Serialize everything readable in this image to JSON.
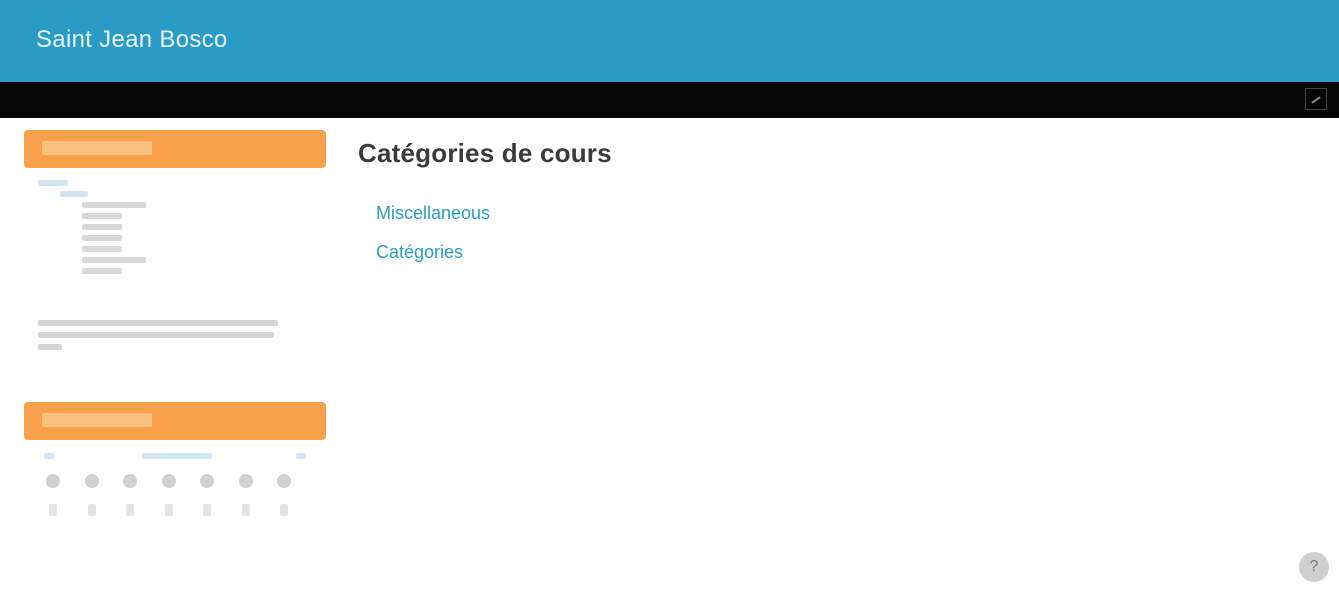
{
  "header": {
    "site_title": "Saint Jean Bosco"
  },
  "sidebar": {
    "navigation_block": {},
    "calendar_block": {
      "weekdays": [
        "",
        "",
        "",
        "",
        "",
        "",
        ""
      ],
      "day_numbers": [
        "",
        "",
        "",
        "",
        "",
        "",
        ""
      ]
    },
    "colors": {
      "block_header": "#f9a04b",
      "link": "#2a9bc7"
    }
  },
  "main": {
    "page_title": "Catégories de cours",
    "search_link": "",
    "categories": [
      {
        "label": "Miscellaneous",
        "level": 0
      },
      {
        "label": "Catégories",
        "level": 0
      },
      {
        "label": "",
        "level": 1
      },
      {
        "label": "",
        "level": 2
      },
      {
        "label": "",
        "level": 2
      },
      {
        "label": "",
        "level": 1
      },
      {
        "label": "",
        "level": 2
      },
      {
        "label": "",
        "level": 3
      },
      {
        "label": "",
        "level": 3
      },
      {
        "label": "",
        "level": 2
      },
      {
        "label": "",
        "level": 1
      },
      {
        "label": "",
        "level": 2
      },
      {
        "label": "",
        "level": 2
      }
    ]
  },
  "colors": {
    "header_bg": "#2a9bc7",
    "nav_bg": "#060606"
  },
  "icons": {
    "nav_toggle": "navbar-toggle-icon",
    "help": "question-icon"
  }
}
